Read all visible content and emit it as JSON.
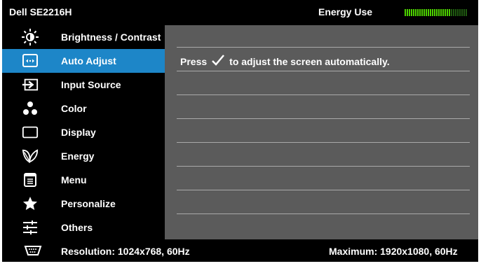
{
  "header": {
    "model": "Dell SE2216H",
    "energy_label": "Energy Use",
    "energy_level": 0.73
  },
  "menu": {
    "items": [
      {
        "label": "Brightness / Contrast",
        "icon": "brightness-icon",
        "selected": false
      },
      {
        "label": "Auto Adjust",
        "icon": "auto-adjust-icon",
        "selected": true
      },
      {
        "label": "Input Source",
        "icon": "input-source-icon",
        "selected": false
      },
      {
        "label": "Color",
        "icon": "color-icon",
        "selected": false
      },
      {
        "label": "Display",
        "icon": "display-icon",
        "selected": false
      },
      {
        "label": "Energy",
        "icon": "energy-icon",
        "selected": false
      },
      {
        "label": "Menu",
        "icon": "menu-icon",
        "selected": false
      },
      {
        "label": "Personalize",
        "icon": "star-icon",
        "selected": false
      },
      {
        "label": "Others",
        "icon": "sliders-icon",
        "selected": false
      }
    ]
  },
  "content": {
    "message_prefix": "Press",
    "message_icon": "checkmark-icon",
    "message_suffix": "to adjust the screen automatically."
  },
  "footer": {
    "connector_icon": "vga-connector-icon",
    "resolution": "Resolution: 1024x768, 60Hz",
    "maximum": "Maximum: 1920x1080, 60Hz"
  },
  "colors": {
    "accent": "#1d86c8",
    "panel": "#5b5b5b",
    "background": "#000000",
    "energy_on": "#4cd000",
    "energy_off": "#1f5a10"
  }
}
